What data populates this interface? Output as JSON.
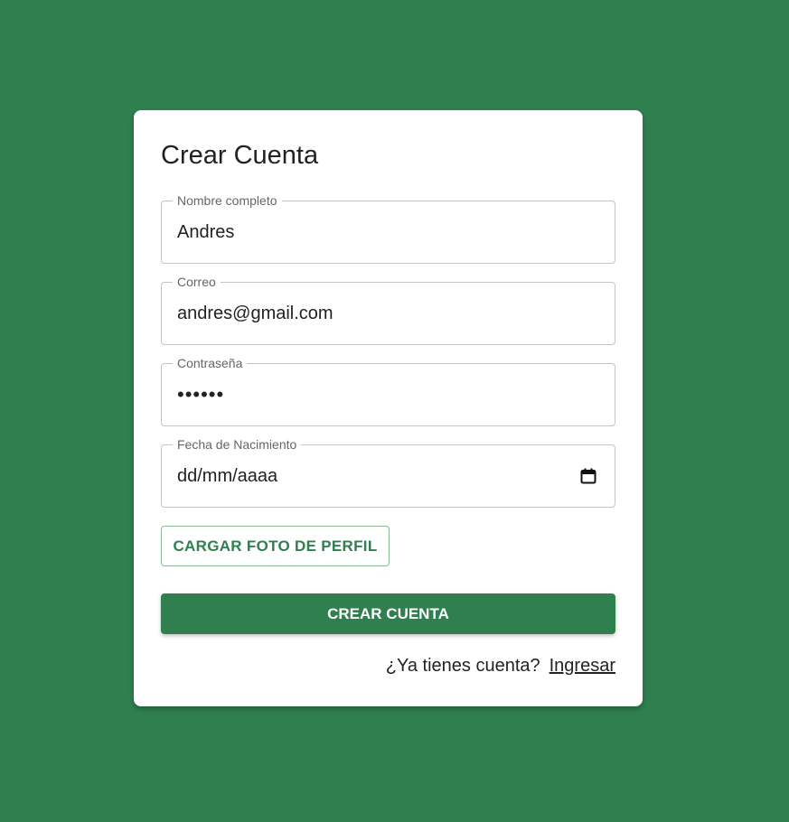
{
  "colors": {
    "background": "#2f7f4f",
    "card": "#ffffff",
    "accent": "#2f7f4f"
  },
  "form": {
    "title": "Crear Cuenta",
    "fields": {
      "nombre": {
        "label": "Nombre completo",
        "value": "Andres"
      },
      "correo": {
        "label": "Correo",
        "value": "andres@gmail.com"
      },
      "contrasena": {
        "label": "Contraseña",
        "value": "••••••"
      },
      "fecha": {
        "label": "Fecha de Nacimiento",
        "value": "dd/mm/aaaa",
        "icon": "calendar-icon"
      }
    },
    "upload_button": "CARGAR FOTO DE PERFIL",
    "submit_button": "CREAR CUENTA",
    "footer": {
      "prompt": "¿Ya tienes cuenta?",
      "link": "Ingresar"
    }
  }
}
